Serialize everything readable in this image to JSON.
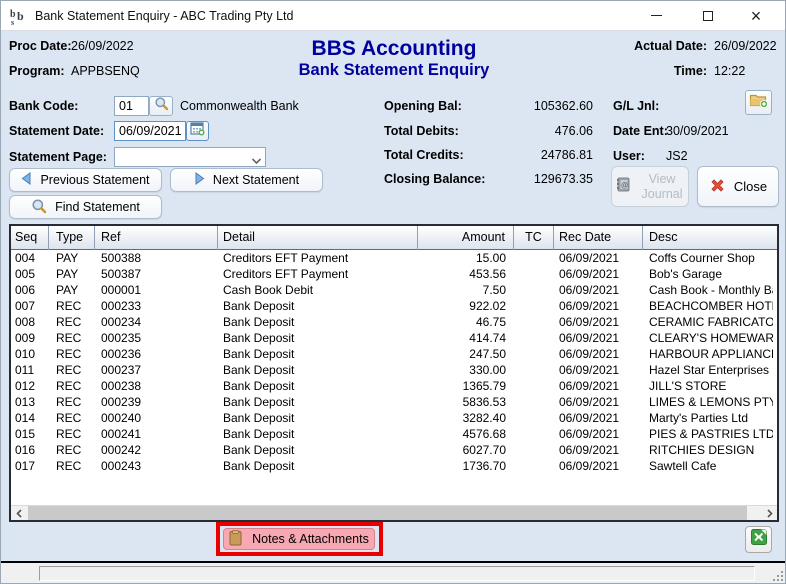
{
  "window": {
    "title": "Bank Statement Enquiry - ABC Trading Pty Ltd"
  },
  "header": {
    "proc_date_label": "Proc Date:",
    "proc_date": "26/09/2022",
    "program_label": "Program:",
    "program": "APPBSENQ",
    "app_title": "BBS Accounting",
    "screen_title": "Bank Statement Enquiry",
    "actual_date_label": "Actual Date:",
    "actual_date": "26/09/2022",
    "time_label": "Time:",
    "time": "12:22"
  },
  "form": {
    "bank_code_label": "Bank Code:",
    "bank_code": "01",
    "bank_name": "Commonwealth Bank",
    "statement_date_label": "Statement Date:",
    "statement_date": "06/09/2021",
    "statement_page_label": "Statement Page:",
    "statement_page": "",
    "prev_button": "Previous Statement",
    "next_button": "Next Statement",
    "find_button": "Find Statement"
  },
  "summary": {
    "opening_bal_label": "Opening Bal:",
    "opening_bal": "105362.60",
    "total_debits_label": "Total Debits:",
    "total_debits": "476.06",
    "total_credits_label": "Total Credits:",
    "total_credits": "24786.81",
    "closing_balance_label": "Closing Balance:",
    "closing_balance": "129673.35"
  },
  "journal": {
    "gl_jnl_label": "G/L Jnl:",
    "gl_jnl": "",
    "date_ent_label": "Date Ent:",
    "date_ent": "30/09/2021",
    "user_label": "User:",
    "user": "JS2",
    "view_journal_button": "View Journal",
    "close_button": "Close"
  },
  "table": {
    "columns": [
      "Seq",
      "Type",
      "Ref",
      "Detail",
      "Amount",
      "TC",
      "Rec Date",
      "Desc"
    ],
    "column_keys": [
      "seq",
      "type",
      "ref",
      "detail",
      "amount",
      "tc",
      "rec_date",
      "desc"
    ],
    "rows": [
      [
        "004",
        "PAY",
        "500388",
        "Creditors EFT Payment",
        "15.00",
        "",
        "06/09/2021",
        "Coffs Courner Shop"
      ],
      [
        "005",
        "PAY",
        "500387",
        "Creditors EFT Payment",
        "453.56",
        "",
        "06/09/2021",
        "Bob's Garage"
      ],
      [
        "006",
        "PAY",
        "000001",
        "Cash Book Debit",
        "7.50",
        "",
        "06/09/2021",
        "Cash Book - Monthly Bar"
      ],
      [
        "007",
        "REC",
        "000233",
        "Bank Deposit",
        "922.02",
        "",
        "06/09/2021",
        "BEACHCOMBER HOTEL"
      ],
      [
        "008",
        "REC",
        "000234",
        "Bank Deposit",
        "46.75",
        "",
        "06/09/2021",
        "CERAMIC FABRICATORS"
      ],
      [
        "009",
        "REC",
        "000235",
        "Bank Deposit",
        "414.74",
        "",
        "06/09/2021",
        "CLEARY'S HOMEWARES"
      ],
      [
        "010",
        "REC",
        "000236",
        "Bank Deposit",
        "247.50",
        "",
        "06/09/2021",
        "HARBOUR APPLIANCES"
      ],
      [
        "011",
        "REC",
        "000237",
        "Bank Deposit",
        "330.00",
        "",
        "06/09/2021",
        "Hazel Star Enterprises"
      ],
      [
        "012",
        "REC",
        "000238",
        "Bank Deposit",
        "1365.79",
        "",
        "06/09/2021",
        "JILL'S STORE"
      ],
      [
        "013",
        "REC",
        "000239",
        "Bank Deposit",
        "5836.53",
        "",
        "06/09/2021",
        "LIMES & LEMONS PTY L"
      ],
      [
        "014",
        "REC",
        "000240",
        "Bank Deposit",
        "3282.40",
        "",
        "06/09/2021",
        "Marty's Parties Ltd"
      ],
      [
        "015",
        "REC",
        "000241",
        "Bank Deposit",
        "4576.68",
        "",
        "06/09/2021",
        "PIES & PASTRIES LTD"
      ],
      [
        "016",
        "REC",
        "000242",
        "Bank Deposit",
        "6027.70",
        "",
        "06/09/2021",
        "RITCHIES DESIGN"
      ],
      [
        "017",
        "REC",
        "000243",
        "Bank Deposit",
        "1736.70",
        "",
        "06/09/2021",
        "Sawtell Cafe"
      ]
    ]
  },
  "footer": {
    "notes_button": "Notes & Attachments"
  },
  "icons": {
    "titlebar_logo": "bbs-logo",
    "bank_code_lookup": "magnifier-icon",
    "statement_date_picker": "calendar-icon",
    "statement_page_dropdown": "chevron-down-icon",
    "prev_button": "arrow-left-icon",
    "next_button": "arrow-right-icon",
    "find_button": "magnifier-icon",
    "gl_jnl_button": "folder-add-icon",
    "view_journal_button": "journal-book-icon",
    "close_button": "red-x-icon",
    "notes_button": "notepad-icon",
    "export_button": "excel-icon"
  },
  "colors": {
    "accent_navy": "#00009c",
    "client_bg": "#dce6f2",
    "annotation_red": "#e60000",
    "notes_pink": "#f8a8b2",
    "excel_green": "#3fa344"
  }
}
